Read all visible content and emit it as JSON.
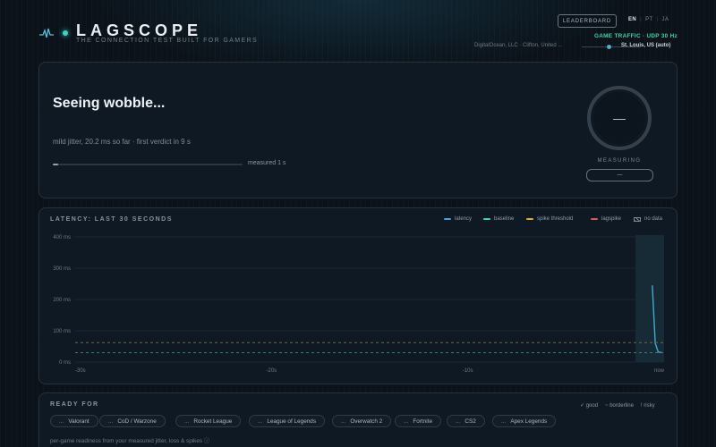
{
  "header": {
    "title": "LAGSCOPE",
    "subtitle": "THE CONNECTION TEST BUILT FOR GAMERS",
    "leaderboard_label": "LEADERBOARD",
    "languages": [
      "EN",
      "PT",
      "JA"
    ],
    "selected_language": "EN",
    "traffic_label": "GAME TRAFFIC · UDP 30 Hz",
    "server_left": "DigitalOcean, LLC · Clifton, United ...",
    "server_right": "St. Louis, US (auto)"
  },
  "status": {
    "title": "Seeing wobble...",
    "detail": "mild jitter, 20.2 ms so far · first verdict in 9 s",
    "progress_label": "measured 1 s",
    "progress_fraction": 0.03,
    "gauge_value": "—",
    "measuring_label": "MEASURING",
    "pill_label": "—"
  },
  "latency_chart": {
    "title": "LATENCY: LAST 30 SECONDS",
    "legend": [
      {
        "label": "latency",
        "color": "#3fa9d6"
      },
      {
        "label": "baseline",
        "color": "#3ad6b4"
      },
      {
        "label": "spike threshold",
        "color": "#d6b23a"
      },
      {
        "label": "lagspike",
        "color": "#d65a5a"
      },
      {
        "label": "no data",
        "color": "#7d8893"
      }
    ]
  },
  "chart_data": {
    "type": "line",
    "title": "LATENCY: LAST 30 SECONDS",
    "xlabel": "",
    "ylabel": "",
    "x_tick_labels": [
      "-30s",
      "-20s",
      "-10s",
      "now"
    ],
    "y_tick_labels": [
      "400 ms",
      "300 ms",
      "200 ms",
      "100 ms",
      "0 ms"
    ],
    "xlim": [
      -30,
      0
    ],
    "ylim": [
      0,
      400
    ],
    "grid": true,
    "legend_position": "top-right",
    "series": [
      {
        "name": "latency",
        "x": [
          -0.6,
          -0.45,
          -0.3,
          -0.1
        ],
        "y": [
          245,
          60,
          32,
          30
        ]
      },
      {
        "name": "baseline",
        "x": [
          -30,
          0
        ],
        "y": [
          30,
          30
        ]
      },
      {
        "name": "spike threshold",
        "x": [
          -30,
          0
        ],
        "y": [
          62,
          62
        ]
      }
    ],
    "no_data_region": [
      -1,
      0
    ]
  },
  "ready": {
    "title": "READY FOR",
    "legend": [
      "✓ good",
      "~ borderline",
      "! risky"
    ],
    "games": [
      "Valorant",
      "CoD / Warzone",
      "Rocket League",
      "League of Legends",
      "Overwatch 2",
      "Fortnite",
      "CS2",
      "Apex Legends"
    ],
    "game_status": "...",
    "note": "per-game readiness from your measured jitter, loss & spikes ⓘ"
  }
}
